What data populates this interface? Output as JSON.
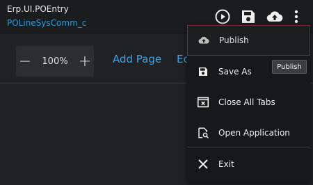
{
  "header": {
    "title": "Erp.UI.POEntry",
    "subtitle": "POLineSysComm_c",
    "icons": [
      "play-circle-icon",
      "save-icon",
      "cloud-upload-icon",
      "more-vert-icon"
    ]
  },
  "toolbar": {
    "zoom_value": "100%",
    "zoom_out_label": "−",
    "zoom_in_label": "+",
    "add_page_label": "Add Page",
    "partial_link_label": "Ec"
  },
  "menu": {
    "items": [
      {
        "label": "Publish",
        "icon": "cloud-upload-icon",
        "active": true
      },
      {
        "label": "Save As",
        "icon": "save-icon"
      },
      {
        "label": "Close All Tabs",
        "icon": "close-tabs-icon"
      },
      {
        "label": "Open Application",
        "icon": "open-application-icon"
      },
      {
        "label": "Exit",
        "icon": "close-icon"
      }
    ]
  },
  "tooltip": {
    "text": "Publish"
  },
  "colors": {
    "accent": "#3aa2e6",
    "subtitle": "#2e9bd6",
    "background": "#1f2224",
    "menu_bg": "#161819",
    "active_border": "#7a2a3a"
  }
}
